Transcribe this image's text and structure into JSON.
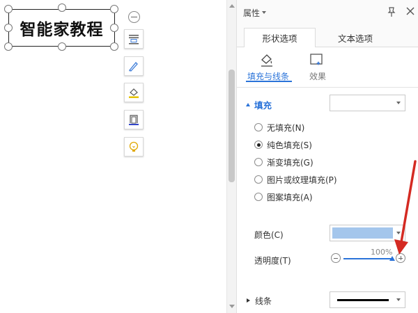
{
  "canvas": {
    "textbox_text": "智能家教程"
  },
  "panel": {
    "title": "属性",
    "tabs": [
      {
        "label": "形状选项",
        "active": true
      },
      {
        "label": "文本选项",
        "active": false
      }
    ],
    "subtabs": [
      {
        "label": "填充与线条",
        "icon": "fill-line-icon",
        "active": true
      },
      {
        "label": "效果",
        "icon": "effect-icon",
        "active": false
      }
    ],
    "fill": {
      "section_label": "填充",
      "options": [
        {
          "label": "无填充(N)",
          "checked": false
        },
        {
          "label": "纯色填充(S)",
          "checked": true
        },
        {
          "label": "渐变填充(G)",
          "checked": false
        },
        {
          "label": "图片或纹理填充(P)",
          "checked": false
        },
        {
          "label": "图案填充(A)",
          "checked": false
        }
      ],
      "color_label": "颜色(C)",
      "color_value": "#a4c6ec",
      "transparency_label": "透明度(T)",
      "transparency_value": "100%",
      "transparency_fraction": 1.0
    },
    "line": {
      "section_label": "线条"
    }
  },
  "colors": {
    "accent": "#2a73d9",
    "annotation": "#d42a22",
    "swatch": "#a4c6ec"
  },
  "icons": {
    "quick_toolbar": [
      "collapse-icon",
      "layout-icon",
      "pen-style-icon",
      "fill-bucket-icon",
      "outline-icon",
      "lightbulb-icon"
    ]
  }
}
